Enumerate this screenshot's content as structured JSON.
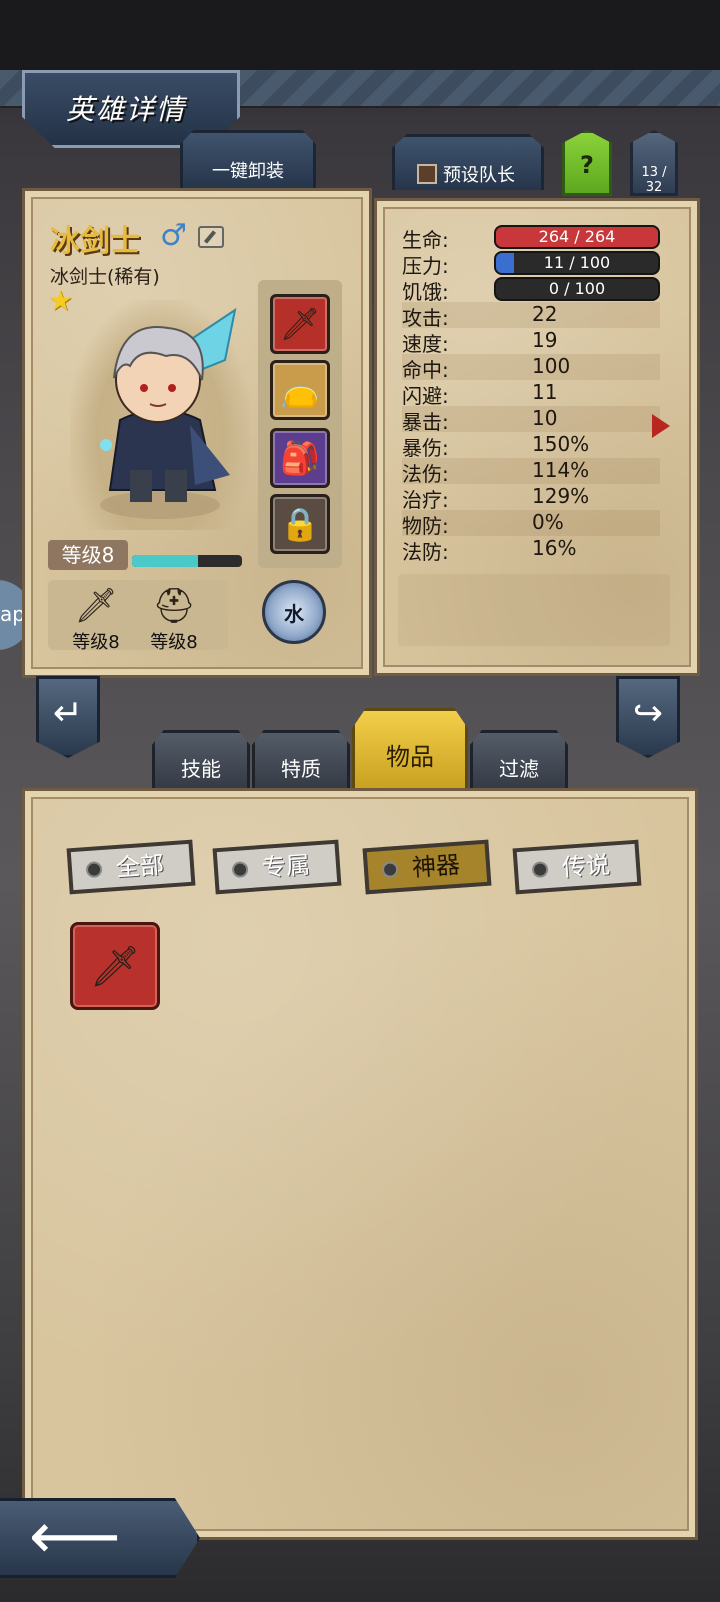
{
  "header": {
    "title": "英雄详情",
    "unequip_all_label": "一键卸装",
    "preset_leader_label": "预设队长",
    "help_label": "?",
    "hero_count": "13 / 32"
  },
  "hero": {
    "name": "冰剑士",
    "subtitle": "冰剑士(稀有)",
    "gender_icon": "male-icon",
    "stars": 1,
    "level_label": "等级8",
    "xp_progress": 0.6,
    "element_label": "水",
    "equipment": [
      {
        "icon": "sword-icon",
        "level_label": "等级8"
      },
      {
        "icon": "helmet-icon",
        "level_label": "等级8"
      }
    ],
    "slots": [
      "weapon-slot",
      "trinket-slot",
      "bag-slot",
      "locked-slot"
    ]
  },
  "stats": {
    "hp": {
      "label": "生命:",
      "value": "264 / 264",
      "fraction": 1.0,
      "color": "#c8373a"
    },
    "stress": {
      "label": "压力:",
      "value": "11 / 100",
      "fraction": 0.11,
      "color": "#3a6fd1"
    },
    "hunger": {
      "label": "饥饿:",
      "value": "0 / 100",
      "fraction": 0.0,
      "color": "#c9a33a"
    },
    "rows": [
      {
        "label": "攻击:",
        "value": "22"
      },
      {
        "label": "速度:",
        "value": "19"
      },
      {
        "label": "命中:",
        "value": "100"
      },
      {
        "label": "闪避:",
        "value": "11"
      },
      {
        "label": "暴击:",
        "value": "10"
      },
      {
        "label": "暴伤:",
        "value": "150%"
      },
      {
        "label": "法伤:",
        "value": "114%"
      },
      {
        "label": "治疗:",
        "value": "129%"
      },
      {
        "label": "物防:",
        "value": "0%"
      },
      {
        "label": "法防:",
        "value": "16%"
      }
    ]
  },
  "tabs": {
    "skill": "技能",
    "trait": "特质",
    "items": "物品",
    "filter": "过滤",
    "active": "items"
  },
  "item_filters": {
    "all": "全部",
    "exclusive": "专属",
    "artifact": "神器",
    "legend": "传说",
    "active": "artifact"
  },
  "side_ring_text": "ap",
  "items": [
    {
      "icon": "crystal-sword-icon"
    }
  ]
}
